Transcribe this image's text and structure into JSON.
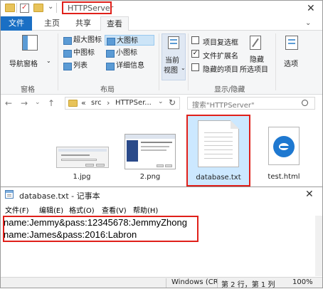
{
  "explorer": {
    "title": "HTTPServer",
    "qat_check_glyph": "✓",
    "close_glyph": "✕",
    "chevron_glyph": "⌄",
    "tabs": [
      "文件",
      "主页",
      "共享",
      "查看"
    ],
    "ribbon": {
      "pane_group": {
        "nav_pane_label": "导航窗格",
        "group_label": "窗格"
      },
      "layout_group": {
        "items": [
          "超大图标",
          "大图标",
          "中图标",
          "小图标",
          "列表",
          "详细信息"
        ],
        "selected": "大图标",
        "group_label": "布局"
      },
      "current_view": {
        "label_line1": "当前",
        "label_line2": "视图"
      },
      "show_hide_group": {
        "item_checkboxes": "项目复选框",
        "file_extensions": "文件扩展名",
        "hidden_items": "隐藏的项目",
        "hide_selected_line1": "隐藏",
        "hide_selected_line2": "所选项目",
        "group_label": "显示/隐藏"
      },
      "options_label": "选项"
    },
    "nav": {
      "back": "←",
      "forward": "→",
      "up": "↑"
    },
    "breadcrumb": {
      "more": "«",
      "sep": "›",
      "segments": [
        "src",
        "HTTPSer..."
      ],
      "dropdown": "⌄",
      "refresh": "↻"
    },
    "search": {
      "placeholder": "搜索\"HTTPServer\""
    },
    "files": [
      {
        "name": "1.jpg"
      },
      {
        "name": "2.png"
      },
      {
        "name": "database.txt"
      },
      {
        "name": "test.html"
      }
    ]
  },
  "notepad": {
    "title": "database.txt - 记事本",
    "close_glyph": "✕",
    "menu": [
      "文件(F)",
      "编辑(E)",
      "格式(O)",
      "查看(V)",
      "帮助(H)"
    ],
    "lines": [
      "name:Jemmy&pass:12345678:JemmyZhong",
      "name:James&pass:2016:Labron"
    ],
    "status": {
      "encoding": "Windows (CR",
      "position": "第 2 行，第 1 列",
      "zoom": "100%"
    }
  },
  "colors": {
    "accent": "#1a6fc4",
    "highlight_box": "#e0201a",
    "selection": "#cce8ff"
  }
}
